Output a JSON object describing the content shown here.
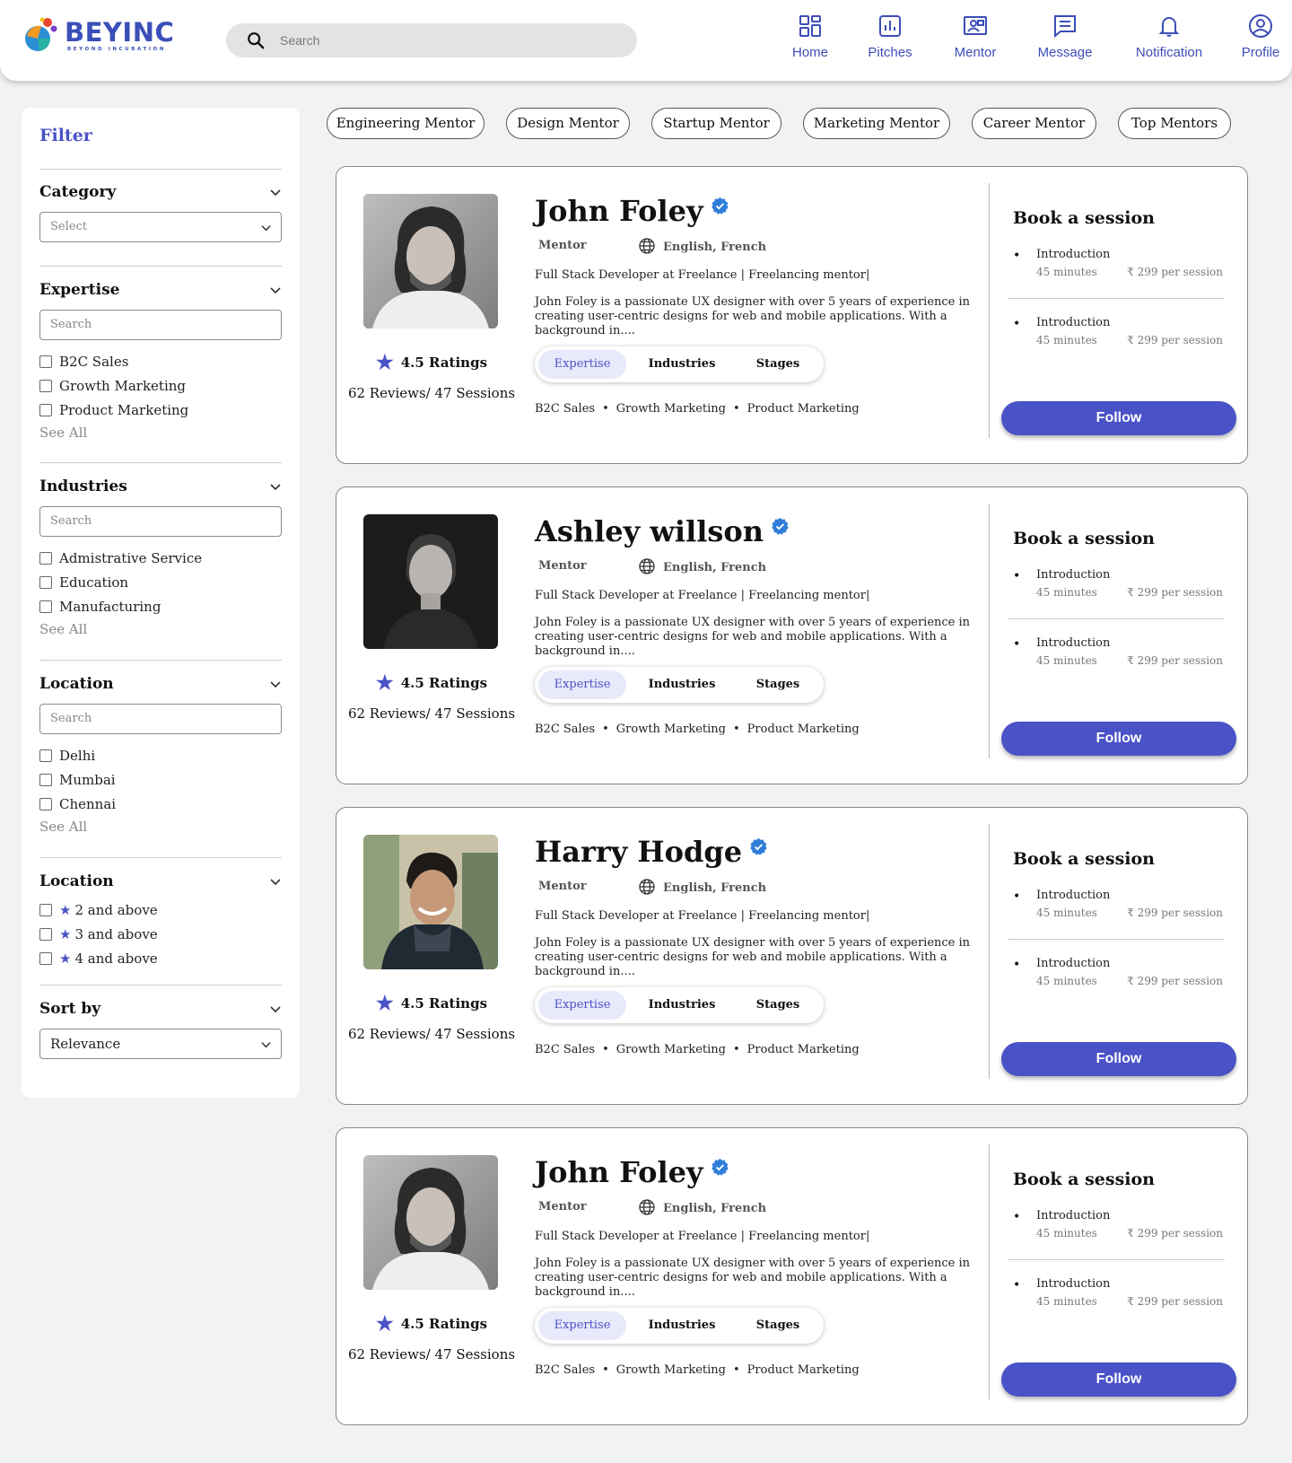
{
  "brand": {
    "name": "BEYINC",
    "tagline": "BEYOND INCUBATION"
  },
  "search": {
    "placeholder": "Search"
  },
  "nav": [
    {
      "label": "Home",
      "icon": "grid-icon"
    },
    {
      "label": "Pitches",
      "icon": "chart-icon"
    },
    {
      "label": "Mentor",
      "icon": "presentation-icon"
    },
    {
      "label": "Message",
      "icon": "message-icon"
    },
    {
      "label": "Notification",
      "icon": "bell-icon"
    },
    {
      "label": "Profile",
      "icon": "user-circle-icon"
    }
  ],
  "filter": {
    "title": "Filter",
    "category": {
      "heading": "Category",
      "select_value": "Select"
    },
    "expertise": {
      "heading": "Expertise",
      "search_placeholder": "Search",
      "options": [
        "B2C Sales",
        "Growth Marketing",
        "Product Marketing"
      ],
      "see_all": "See All"
    },
    "industries": {
      "heading": "Industries",
      "search_placeholder": "Search",
      "options": [
        "Admistrative Service",
        "Education",
        "Manufacturing"
      ],
      "see_all": "See All"
    },
    "location": {
      "heading": "Location",
      "search_placeholder": "Search",
      "options": [
        "Delhi",
        "Mumbai",
        "Chennai"
      ],
      "see_all": "See All"
    },
    "rating": {
      "heading": "Location",
      "options": [
        "2 and above",
        "3 and above",
        "4 and above"
      ]
    },
    "sort": {
      "heading": "Sort by",
      "value": "Relevance"
    }
  },
  "chips": [
    "Engineering Mentor",
    "Design Mentor",
    "Startup Mentor",
    "Marketing Mentor",
    "Career Mentor",
    "Top Mentors"
  ],
  "colors": {
    "accent": "#4a52c7",
    "brand": "#3b4fb8",
    "verified": "#2f7fd8"
  },
  "mentors": [
    {
      "name": "John Foley",
      "role": "Mentor",
      "languages": "English, French",
      "title": "Full Stack Developer at Freelance  | Freelancing mentor|",
      "bio": "John Foley is a passionate UX designer with over 5 years of experience in creating user-centric designs for web and mobile applications. With a background in....",
      "rating": "4.5 Ratings",
      "reviews": "62 Reviews/ 47 Sessions",
      "tabs": [
        "Expertise",
        "Industries",
        "Stages"
      ],
      "tags": [
        "B2C Sales",
        "Growth Marketing",
        "Product Marketing"
      ],
      "book_title": "Book a session",
      "sessions": [
        {
          "name": "Introduction",
          "duration": "45 minutes",
          "price": "₹ 299 per session"
        },
        {
          "name": "Introduction",
          "duration": "45 minutes",
          "price": "₹ 299 per session"
        }
      ],
      "follow": "Follow"
    },
    {
      "name": "Ashley willson",
      "role": "Mentor",
      "languages": "English, French",
      "title": "Full Stack Developer at Freelance  | Freelancing mentor|",
      "bio": "John Foley is a passionate UX designer with over 5 years of experience in creating user-centric designs for web and mobile applications. With a background in....",
      "rating": "4.5 Ratings",
      "reviews": "62 Reviews/ 47 Sessions",
      "tabs": [
        "Expertise",
        "Industries",
        "Stages"
      ],
      "tags": [
        "B2C Sales",
        "Growth Marketing",
        "Product Marketing"
      ],
      "book_title": "Book a session",
      "sessions": [
        {
          "name": "Introduction",
          "duration": "45 minutes",
          "price": "₹ 299 per session"
        },
        {
          "name": "Introduction",
          "duration": "45 minutes",
          "price": "₹ 299 per session"
        }
      ],
      "follow": "Follow"
    },
    {
      "name": "Harry Hodge",
      "role": "Mentor",
      "languages": "English, French",
      "title": "Full Stack Developer at Freelance  | Freelancing mentor|",
      "bio": "John Foley is a passionate UX designer with over 5 years of experience in creating user-centric designs for web and mobile applications. With a background in....",
      "rating": "4.5 Ratings",
      "reviews": "62 Reviews/ 47 Sessions",
      "tabs": [
        "Expertise",
        "Industries",
        "Stages"
      ],
      "tags": [
        "B2C Sales",
        "Growth Marketing",
        "Product Marketing"
      ],
      "book_title": "Book a session",
      "sessions": [
        {
          "name": "Introduction",
          "duration": "45 minutes",
          "price": "₹ 299 per session"
        },
        {
          "name": "Introduction",
          "duration": "45 minutes",
          "price": "₹ 299 per session"
        }
      ],
      "follow": "Follow"
    },
    {
      "name": "John Foley",
      "role": "Mentor",
      "languages": "English, French",
      "title": "Full Stack Developer at Freelance  | Freelancing mentor|",
      "bio": "John Foley is a passionate UX designer with over 5 years of experience in creating user-centric designs for web and mobile applications. With a background in....",
      "rating": "4.5 Ratings",
      "reviews": "62 Reviews/ 47 Sessions",
      "tabs": [
        "Expertise",
        "Industries",
        "Stages"
      ],
      "tags": [
        "B2C Sales",
        "Growth Marketing",
        "Product Marketing"
      ],
      "book_title": "Book a session",
      "sessions": [
        {
          "name": "Introduction",
          "duration": "45 minutes",
          "price": "₹ 299 per session"
        },
        {
          "name": "Introduction",
          "duration": "45 minutes",
          "price": "₹ 299 per session"
        }
      ],
      "follow": "Follow"
    }
  ]
}
